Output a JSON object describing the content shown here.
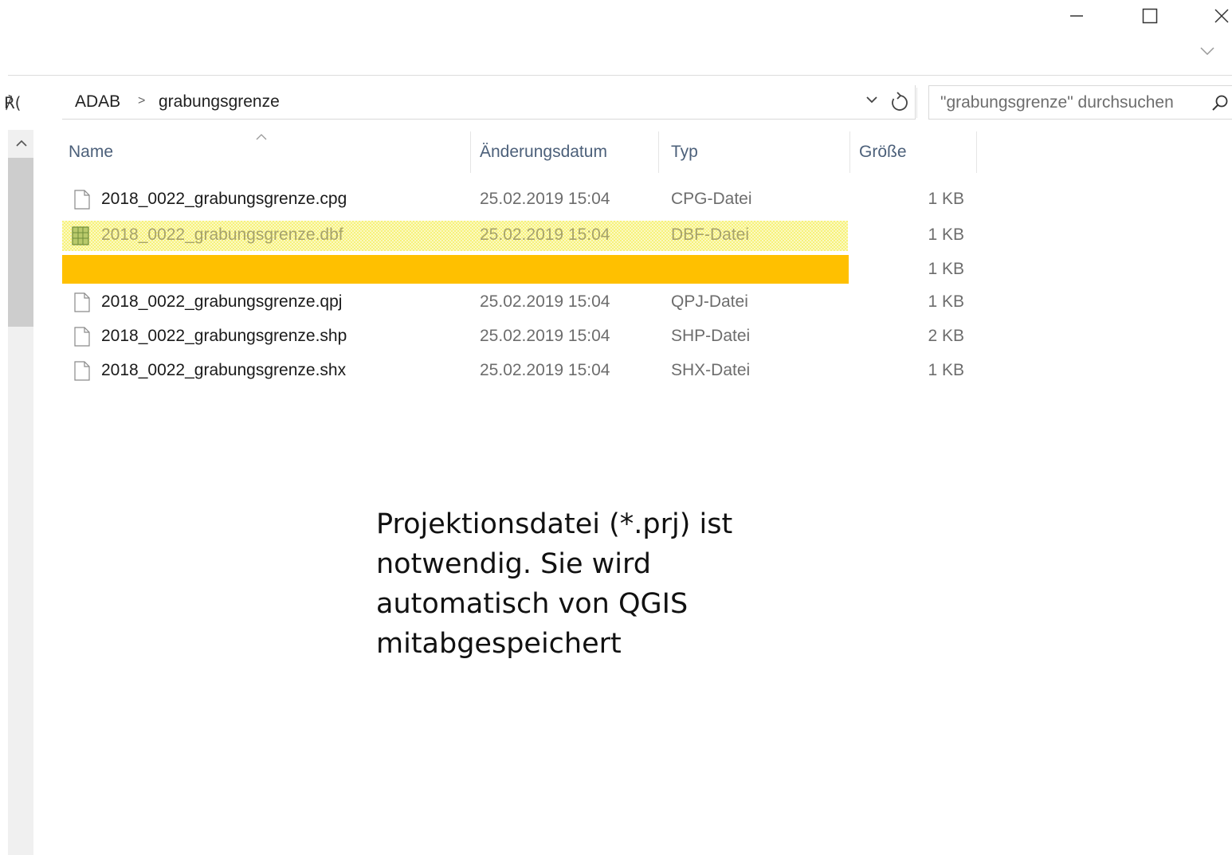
{
  "window": {
    "minimize_icon": "minimize-icon",
    "maximize_icon": "maximize-icon",
    "close_icon": "close-icon"
  },
  "nav": {
    "left_fragment": "℟("
  },
  "address": {
    "crumbs": [
      "ADAB",
      "grabungsgrenze"
    ],
    "separator": ">"
  },
  "search": {
    "placeholder": "\"grabungsgrenze\" durchsuchen"
  },
  "columns": {
    "name": "Name",
    "date": "Änderungsdatum",
    "type": "Typ",
    "size": "Größe"
  },
  "files": [
    {
      "name": "2018_0022_grabungsgrenze.cpg",
      "date": "25.02.2019 15:04",
      "type": "CPG-Datei",
      "size": "1 KB"
    },
    {
      "name": "2018_0022_grabungsgrenze.dbf",
      "date": "25.02.2019 15:04",
      "type": "DBF-Datei",
      "size": "1 KB"
    },
    {
      "name": "",
      "date": "",
      "type": "",
      "size": "1 KB"
    },
    {
      "name": "2018_0022_grabungsgrenze.qpj",
      "date": "25.02.2019 15:04",
      "type": "QPJ-Datei",
      "size": "1 KB"
    },
    {
      "name": "2018_0022_grabungsgrenze.shp",
      "date": "25.02.2019 15:04",
      "type": "SHP-Datei",
      "size": "2 KB"
    },
    {
      "name": "2018_0022_grabungsgrenze.shx",
      "date": "25.02.2019 15:04",
      "type": "SHX-Datei",
      "size": "1 KB"
    }
  ],
  "annotation": {
    "lines": [
      "Projektionsdatei (*.prj) ist",
      "notwendig. Sie wird",
      "automatisch von QGIS",
      "mitabgespeichert"
    ]
  },
  "colors": {
    "highlight_yellow": "#f7f27b",
    "highlight_orange": "#ffc000",
    "header_text": "#4c607a"
  }
}
